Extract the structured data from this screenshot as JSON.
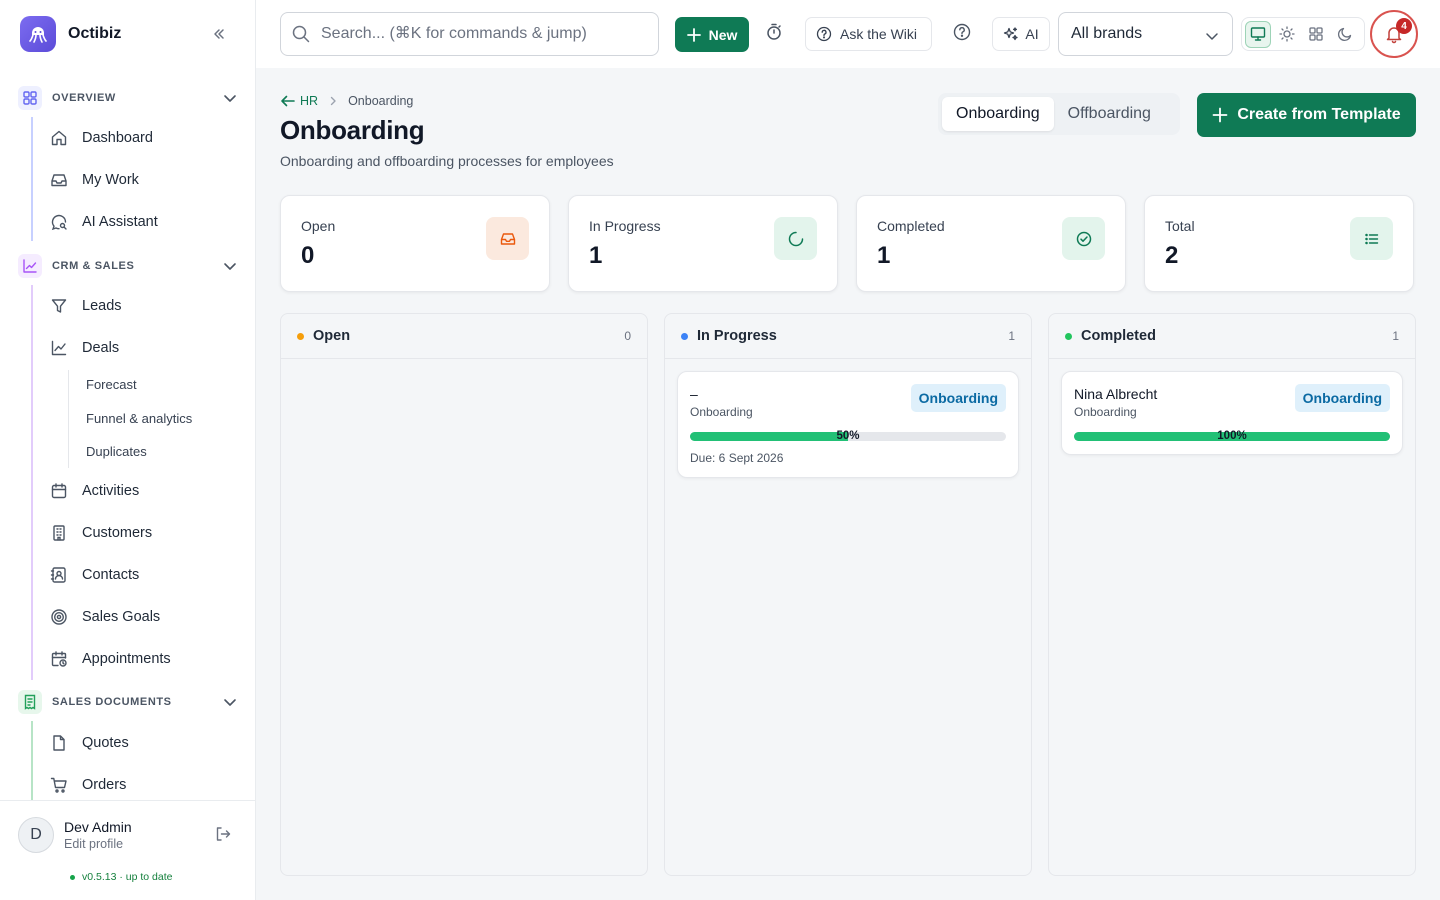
{
  "app": {
    "name": "Octibiz"
  },
  "sidebar": {
    "sections": [
      {
        "label": "OVERVIEW",
        "color": "#6366f1",
        "items": [
          {
            "label": "Dashboard",
            "icon": "home-icon"
          },
          {
            "label": "My Work",
            "icon": "inbox-icon"
          },
          {
            "label": "AI Assistant",
            "icon": "chat-search-icon"
          }
        ]
      },
      {
        "label": "CRM & SALES",
        "color": "#a855f7",
        "items": [
          {
            "label": "Leads",
            "icon": "funnel-icon"
          },
          {
            "label": "Deals",
            "icon": "trend-chart-icon"
          },
          {
            "label": "Activities",
            "icon": "calendar-icon"
          },
          {
            "label": "Customers",
            "icon": "building-icon"
          },
          {
            "label": "Contacts",
            "icon": "contact-card-icon"
          },
          {
            "label": "Sales Goals",
            "icon": "target-icon"
          },
          {
            "label": "Appointments",
            "icon": "calendar-clock-icon"
          }
        ]
      },
      {
        "label": "SALES DOCUMENTS",
        "color": "#22c55e",
        "items": [
          {
            "label": "Quotes",
            "icon": "document-icon"
          },
          {
            "label": "Orders",
            "icon": "cart-icon"
          }
        ]
      }
    ],
    "deal_subitems": [
      "Forecast",
      "Funnel & analytics",
      "Duplicates"
    ],
    "user": {
      "initial": "D",
      "name": "Dev Admin",
      "edit": "Edit profile"
    },
    "version": "v0.5.13 · up to date"
  },
  "topbar": {
    "search_placeholder": "Search... (⌘K for commands & jump)",
    "new_label": "New",
    "wiki_label": "Ask the Wiki",
    "ai_label": "AI",
    "brand_select": "All brands",
    "notifications": "4",
    "accent": "#0f7a55"
  },
  "page": {
    "breadcrumb_parent": "HR",
    "breadcrumb_current": "Onboarding",
    "title": "Onboarding",
    "subtitle": "Onboarding and offboarding processes for employees",
    "tabs": [
      {
        "label": "Onboarding",
        "active": true
      },
      {
        "label": "Offboarding",
        "active": false
      }
    ],
    "create_label": "Create from Template"
  },
  "stats": [
    {
      "label": "Open",
      "value": "0",
      "icon": "inbox-icon",
      "color": "#ea580c"
    },
    {
      "label": "In Progress",
      "value": "1",
      "icon": "progress-icon",
      "color": "#0f7a55"
    },
    {
      "label": "Completed",
      "value": "1",
      "icon": "check-circle-icon",
      "color": "#0f7a55"
    },
    {
      "label": "Total",
      "value": "2",
      "icon": "list-icon",
      "color": "#0f7a55"
    }
  ],
  "columns": [
    {
      "title": "Open",
      "count": "0",
      "color": "#f59e0b",
      "cards": []
    },
    {
      "title": "In Progress",
      "count": "1",
      "color": "#3b82f6",
      "cards": [
        {
          "name": "–",
          "type": "Onboarding",
          "badge": "Onboarding",
          "progress": 50,
          "progress_label": "50%",
          "due": "Due: 6 Sept 2026"
        }
      ]
    },
    {
      "title": "Completed",
      "count": "1",
      "color": "#22c55e",
      "cards": [
        {
          "name": "Nina Albrecht",
          "type": "Onboarding",
          "badge": "Onboarding",
          "progress": 100,
          "progress_label": "100%"
        }
      ]
    }
  ]
}
